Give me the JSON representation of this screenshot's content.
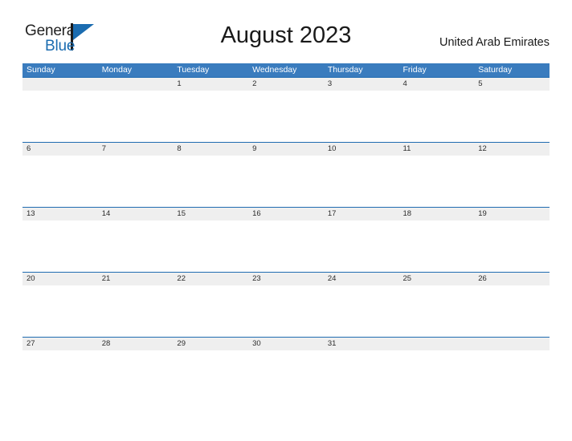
{
  "logo": {
    "primary_text": "General",
    "secondary_text": "Blue",
    "primary_color": "#222222",
    "secondary_color": "#1b6cb0"
  },
  "header": {
    "title": "August 2023",
    "region": "United Arab Emirates"
  },
  "colors": {
    "header_blue": "#3a7cbe",
    "rule_blue": "#1f6bb0",
    "band_gray": "#efefef",
    "text_dark": "#2b2b2b",
    "background": "#ffffff"
  },
  "calendar": {
    "month": "August",
    "year": "2023",
    "weekday_headers": [
      "Sunday",
      "Monday",
      "Tuesday",
      "Wednesday",
      "Thursday",
      "Friday",
      "Saturday"
    ],
    "weeks": [
      {
        "days": [
          "",
          "",
          "1",
          "2",
          "3",
          "4",
          "5"
        ]
      },
      {
        "days": [
          "6",
          "7",
          "8",
          "9",
          "10",
          "11",
          "12"
        ]
      },
      {
        "days": [
          "13",
          "14",
          "15",
          "16",
          "17",
          "18",
          "19"
        ]
      },
      {
        "days": [
          "20",
          "21",
          "22",
          "23",
          "24",
          "25",
          "26"
        ]
      },
      {
        "days": [
          "27",
          "28",
          "29",
          "30",
          "31",
          "",
          ""
        ]
      }
    ]
  }
}
